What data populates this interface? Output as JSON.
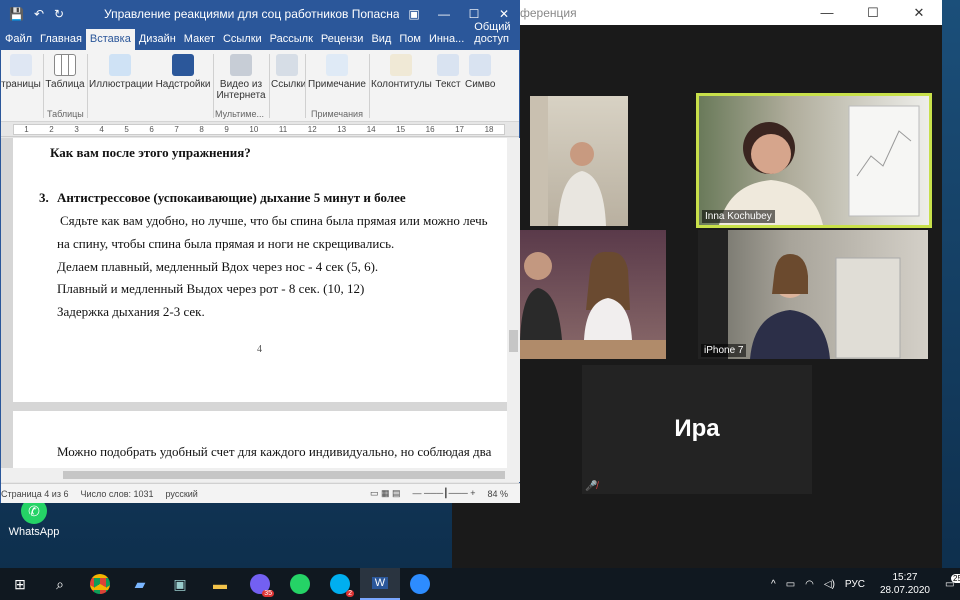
{
  "desktop": {
    "whatsapp_label": "WhatsApp"
  },
  "zoom": {
    "title": "ференция",
    "controls": [
      "—",
      "☐",
      "✕"
    ],
    "participants": [
      {
        "name": ""
      },
      {
        "name": "Inna Kochubey"
      },
      {
        "name": ""
      },
      {
        "name": "iPhone 7"
      },
      {
        "name": "Ира"
      }
    ]
  },
  "word": {
    "title": "Управление реакциями для соц работников Попасная.docx...",
    "quick_access": [
      "💾",
      "↶",
      "↻"
    ],
    "window_controls": [
      "▣",
      "—",
      "☐",
      "✕"
    ],
    "tabs": [
      "Файл",
      "Главная",
      "Вставка",
      "Дизайн",
      "Макет",
      "Ссылки",
      "Рассылк",
      "Рецензи",
      "Вид",
      "Пом",
      "Инна...",
      "Общий доступ"
    ],
    "ribbon": {
      "buttons": [
        "траницы",
        "Таблица",
        "Иллюстрации",
        "Надстройки",
        "Видео из Интернета",
        "Ссылки",
        "Примечание",
        "Колонтитулы",
        "Текст",
        "Симво"
      ],
      "groups": [
        "Таблицы",
        "Мультиме...",
        "Примечания"
      ]
    },
    "ruler_marks": [
      "1",
      "2",
      "3",
      "4",
      "5",
      "6",
      "7",
      "8",
      "9",
      "10",
      "11",
      "12",
      "13",
      "14",
      "15",
      "16",
      "17",
      "18"
    ],
    "page4": {
      "line1": "Как вам после этого упражнения?",
      "item_num": "3.",
      "item_title": "Антистрессовое (успокаивающие) дыхание 5 минут и более",
      "line2": "Сядьте как вам удобно, но лучше, что бы спина была прямая или можно лечь",
      "line3": "на спину, чтобы спина была прямая и ноги не скрещивались.",
      "line4": "Делаем плавный, медленный Вдох через нос - 4 сек (5, 6).",
      "line5": "Плавный и медленный Выдох через рот - 8 сек. (10, 12)",
      "line6": "Задержка дыхания 2-3 сек.",
      "page_number": "4"
    },
    "page5": {
      "line1": "Можно подобрать удобный счет для каждого индивидуально, но соблюдая два"
    },
    "status": {
      "page": "Страница 4 из 6",
      "words": "Число слов: 1031",
      "lang": "русский",
      "zoom": "84 %"
    }
  },
  "taskbar": {
    "lang": "РУС",
    "time": "15:27",
    "date": "28.07.2020",
    "viber_badge": "35",
    "skype_badge": "2",
    "notifications": "25"
  },
  "colors": {
    "word_blue": "#2b579a",
    "zoom_active": "#c8e04a"
  }
}
